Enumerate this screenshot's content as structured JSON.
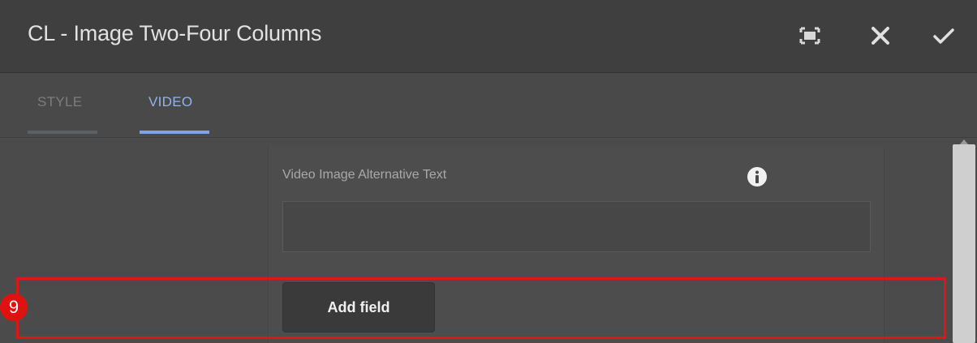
{
  "dialog": {
    "title": "CL - Image Two-Four Columns",
    "header_icons": [
      "fullscreen-icon",
      "close-icon",
      "checkmark-icon"
    ]
  },
  "tabs": [
    {
      "label": "STYLE",
      "active": false
    },
    {
      "label": "VIDEO",
      "active": true
    }
  ],
  "form": {
    "field_label": "Video Image Alternative Text",
    "field_value": "",
    "info_icon": "info-icon",
    "add_field_label": "Add field"
  },
  "annotation": {
    "step_number": "9",
    "highlight_color": "#e01515"
  },
  "colors": {
    "accent": "#7aa5ec",
    "header_bg": "#3f3f3f",
    "body_bg": "#4b4b4b"
  }
}
